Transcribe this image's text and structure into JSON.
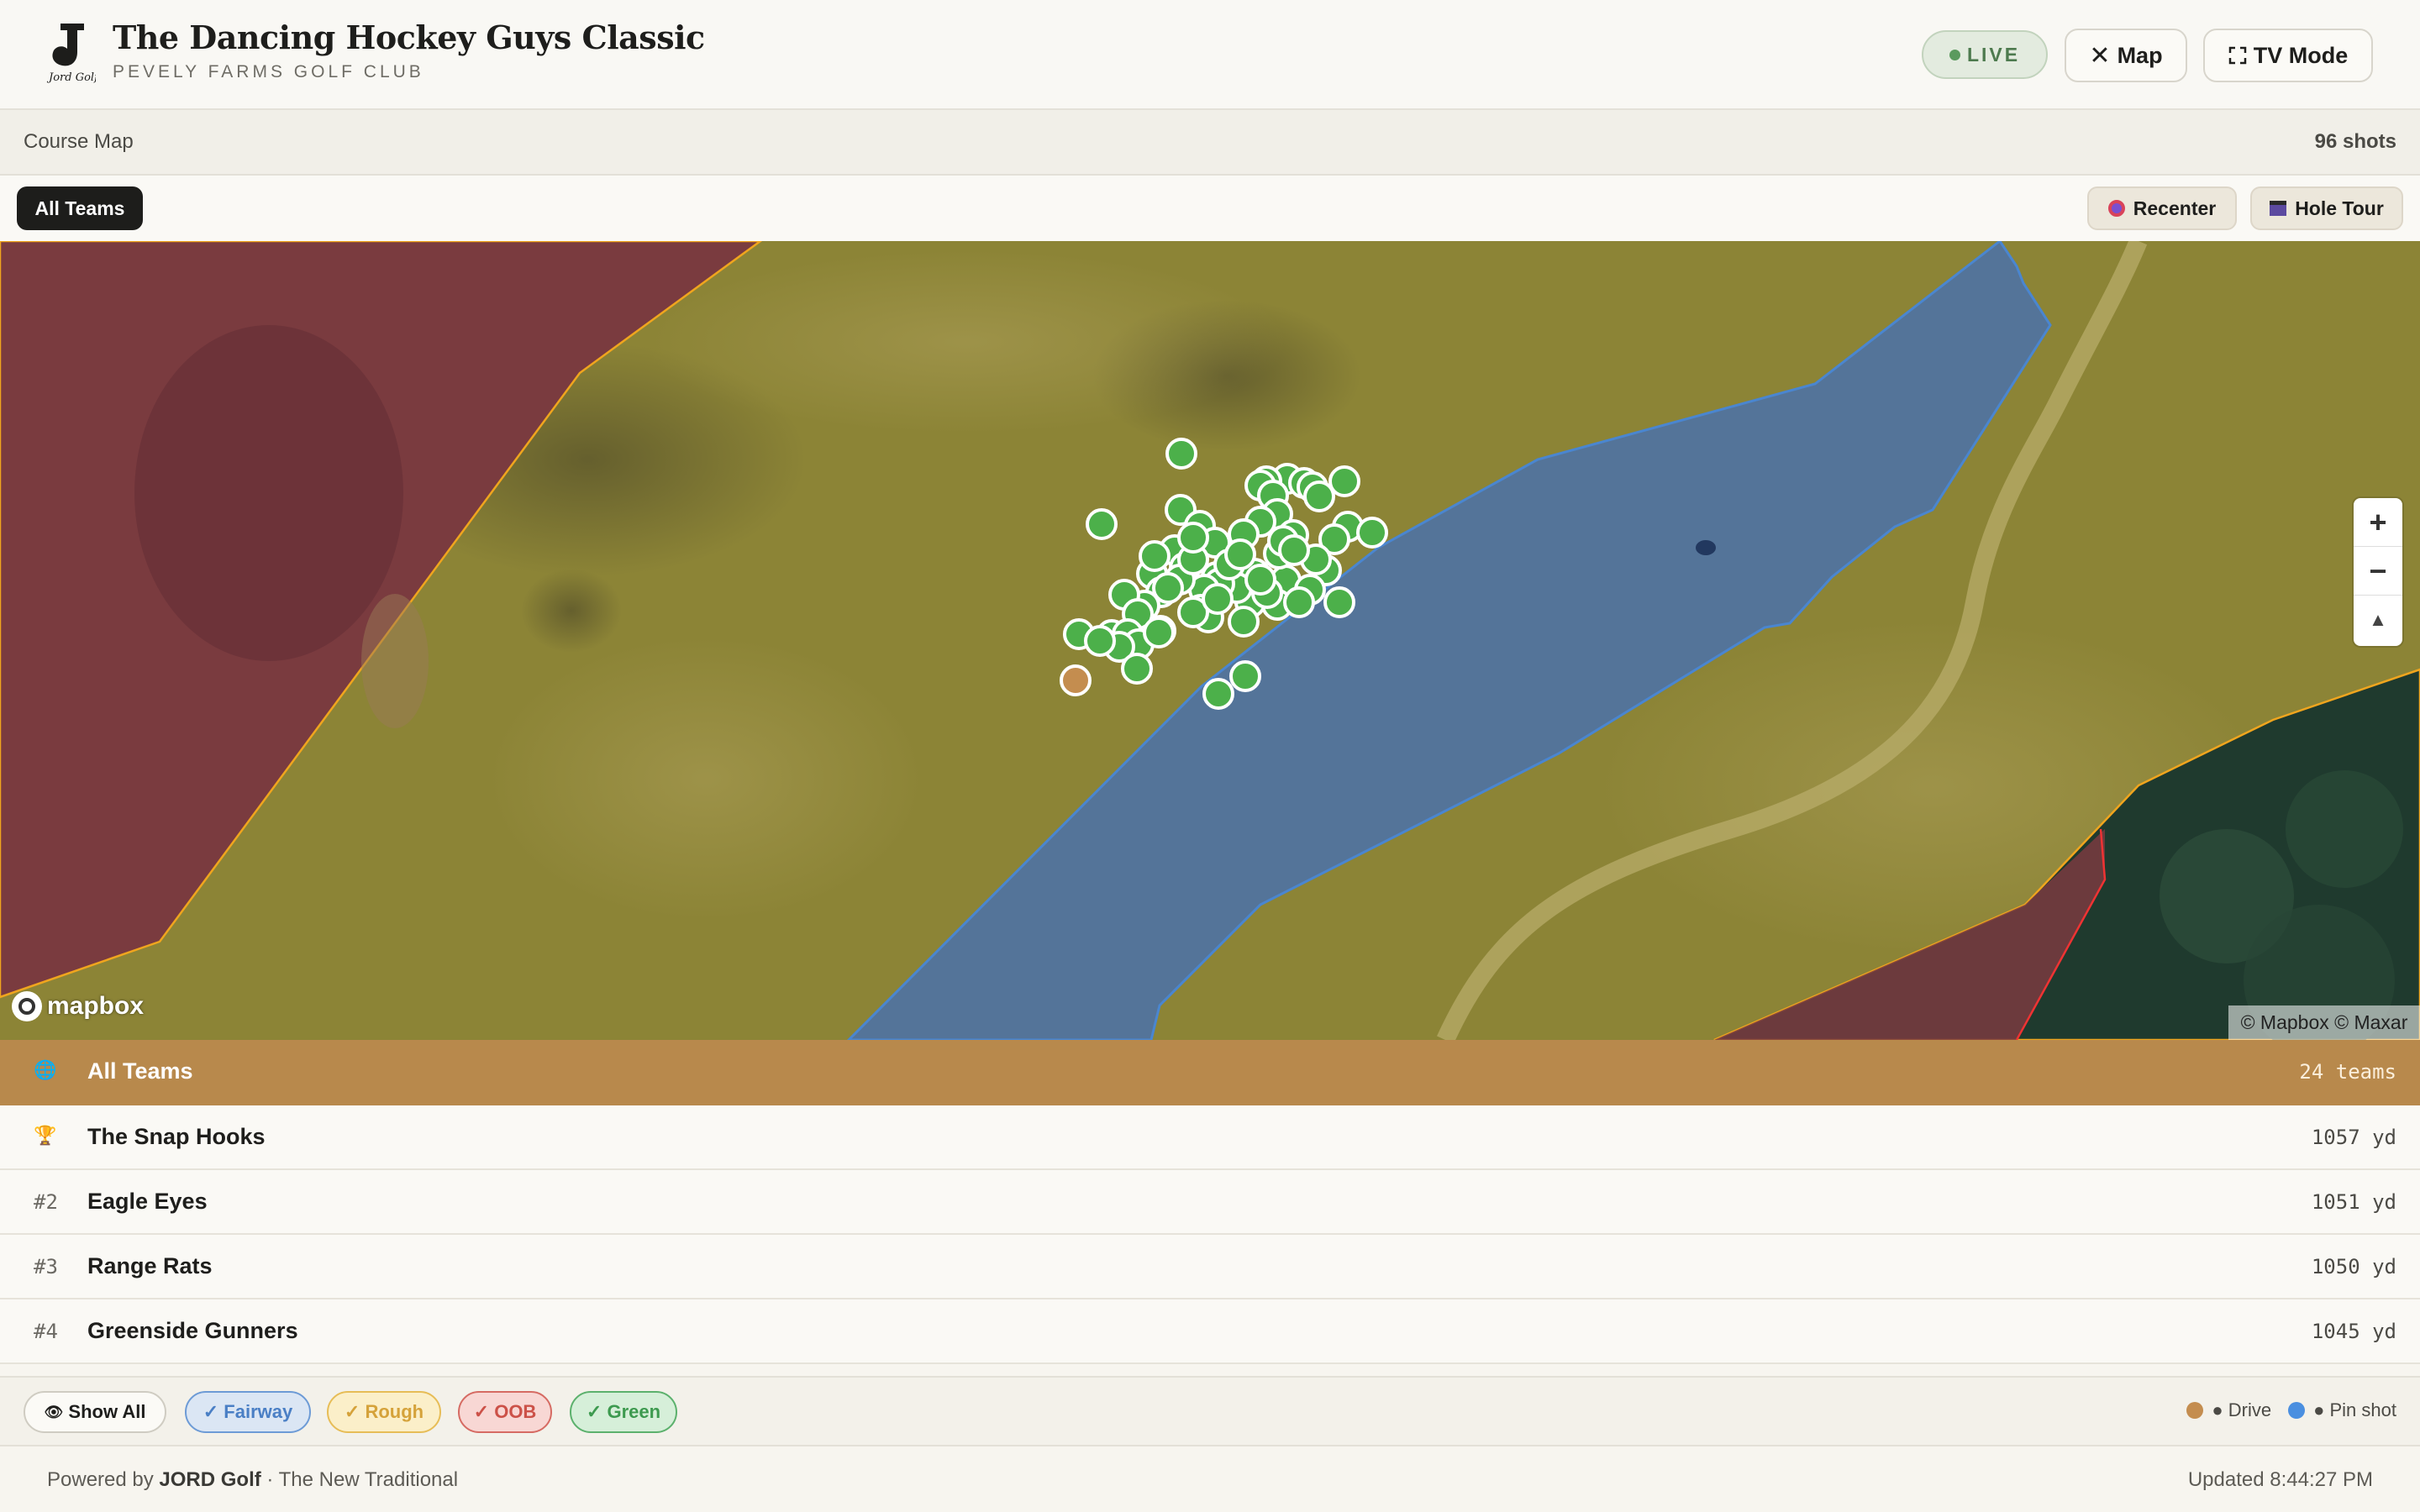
{
  "header": {
    "title": "The Dancing Hockey Guys Classic",
    "subtitle": "PEVELY FARMS GOLF CLUB",
    "live_label": "LIVE",
    "map_label": "Map",
    "tv_label": "TV Mode"
  },
  "section": {
    "title": "Course Map",
    "shots": "96 shots"
  },
  "controls": {
    "all_teams": "All Teams",
    "recenter": "Recenter",
    "hole_tour": "Hole Tour"
  },
  "map": {
    "zoom_in": "+",
    "zoom_out": "−",
    "compass": "▲",
    "logo_text": "mapbox",
    "attribution": "© Mapbox © Maxar",
    "colors": {
      "drive": "#c48d4f",
      "pin_shot": "#4a8fe0",
      "shot": "#4cb04a",
      "fairway_fill": "#3e6dbf",
      "rough_fill": "#a49b2e",
      "oob_fill": "#7a2e3c"
    }
  },
  "teams": {
    "all": {
      "icon": "🌐",
      "name": "All Teams",
      "value": "24 teams"
    },
    "rows": [
      {
        "rank": "🏆",
        "name": "The Snap Hooks",
        "value": "1057 yd"
      },
      {
        "rank": "#2",
        "name": "Eagle Eyes",
        "value": "1051 yd"
      },
      {
        "rank": "#3",
        "name": "Range Rats",
        "value": "1050 yd"
      },
      {
        "rank": "#4",
        "name": "Greenside Gunners",
        "value": "1045 yd"
      }
    ]
  },
  "filters": {
    "show_all": "Show All",
    "fairway": "✓ Fairway",
    "rough": "✓ Rough",
    "oob": "✓ OOB",
    "green": "✓ Green"
  },
  "legend": {
    "drive": "● Drive",
    "pin": "● Pin shot"
  },
  "footer": {
    "powered_prefix": "Powered by ",
    "brand": "JORD Golf",
    "tagline": " · The New Traditional",
    "updated": "Updated 8:44:27 PM"
  }
}
